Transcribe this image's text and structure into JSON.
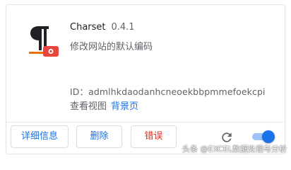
{
  "extension": {
    "name": "Charset",
    "version": "0.4.1",
    "description": "修改网站的默认编码",
    "id_text": "ID：admlhkdaodanhcneoekbbpmmefoekcpi",
    "views_label": "查看视图",
    "views_link": "背景页",
    "enabled": true
  },
  "buttons": {
    "details": "详细信息",
    "remove": "删除",
    "errors": "错误"
  },
  "icons": {
    "extension_icon": "pilcrow-with-red-badge-icon",
    "reload": "reload-icon",
    "toggle": "enable-toggle"
  },
  "colors": {
    "link": "#1a73e8",
    "error": "#d93025",
    "toggle_on": "#1a73e8"
  },
  "watermark": "头条 @EXCEL数据处理与分析"
}
